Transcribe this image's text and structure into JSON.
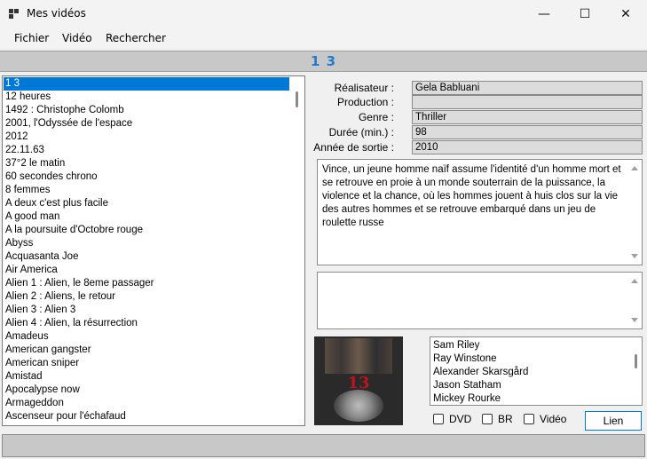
{
  "window": {
    "title": "Mes vidéos",
    "minimize_glyph": "—",
    "maximize_glyph": "☐",
    "close_glyph": "✕"
  },
  "menu": [
    "Fichier",
    "Vidéo",
    "Rechercher"
  ],
  "current_title": "1 3",
  "film_list": [
    "1 3",
    "12 heures",
    "1492 : Christophe Colomb",
    "2001, l'Odyssée de l'espace",
    "2012",
    "22.11.63",
    "37°2 le matin",
    "60 secondes chrono",
    "8 femmes",
    "A deux c'est plus facile",
    "A good man",
    "A la poursuite d'Octobre rouge",
    "Abyss",
    "Acquasanta Joe",
    "Air America",
    "Alien 1 : Alien, le 8eme passager",
    "Alien 2 : Aliens, le retour",
    "Alien 3 : Alien 3",
    "Alien 4 : Alien, la résurrection",
    "Amadeus",
    "American gangster",
    "American sniper",
    "Amistad",
    "Apocalypse now",
    "Armageddon",
    "Ascenseur pour l'échafaud"
  ],
  "selected_film": "1 3",
  "details": {
    "realisateur_label": "Réalisateur :",
    "realisateur": "Gela Babluani",
    "production_label": "Production :",
    "production": "",
    "genre_label": "Genre :",
    "genre": "Thriller",
    "duree_label": "Durée (min.) :",
    "duree": "98",
    "annee_label": "Année de sortie :",
    "annee": "2010"
  },
  "synopsis": "Vince, un jeune homme naïf assume l'identité d'un homme mort et se retrouve en proie à un monde souterrain de la puissance, la violence et la chance, où les hommes jouent à huis clos sur la vie des autres hommes et se retrouve embarqué dans un jeu de roulette russe",
  "notes": "",
  "poster": {
    "label": "13"
  },
  "actors": [
    "Sam Riley",
    "Ray Winstone",
    "Alexander Skarsgård",
    "Jason Statham",
    "Mickey Rourke"
  ],
  "formats": {
    "dvd": "DVD",
    "br": "BR",
    "video": "Vidéo"
  },
  "buttons": {
    "lien": "Lien"
  },
  "colors": {
    "selection": "#0078d7",
    "title_accent": "#1f7bd1"
  }
}
